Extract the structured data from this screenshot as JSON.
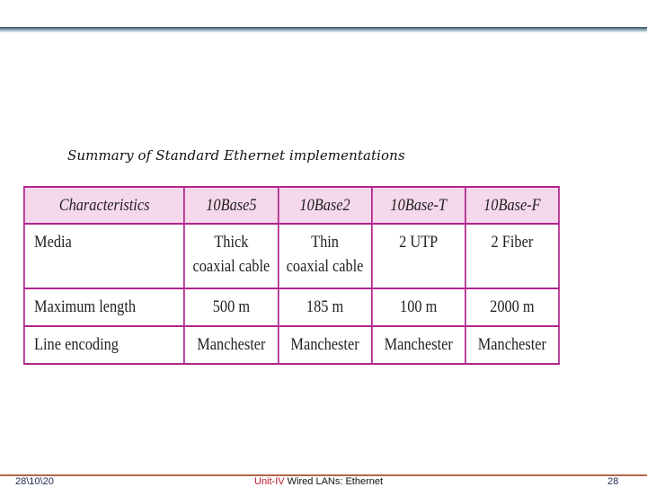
{
  "slide": {
    "caption": "Summary of Standard Ethernet implementations",
    "table": {
      "headers": [
        "Characteristics",
        "10Base5",
        "10Base2",
        "10Base-T",
        "10Base-F"
      ],
      "rows": [
        {
          "label": "Media",
          "values": [
            "Thick coaxial cable",
            "Thin coaxial cable",
            "2 UTP",
            "2 Fiber"
          ],
          "lines": [
            [
              "Thick",
              "coaxial cable"
            ],
            [
              "Thin",
              "coaxial cable"
            ],
            [
              "2 UTP",
              ""
            ],
            [
              "2 Fiber",
              ""
            ]
          ]
        },
        {
          "label": "Maximum length",
          "values": [
            "500 m",
            "185 m",
            "100 m",
            "2000 m"
          ]
        },
        {
          "label": "Line encoding",
          "values": [
            "Manchester",
            "Manchester",
            "Manchester",
            "Manchester"
          ]
        }
      ]
    },
    "colors": {
      "header_bg": "#f5d8ec",
      "border": "#b0268e",
      "footer_rule": "#b5664a",
      "unit_label": "#c0162a"
    }
  },
  "footer": {
    "date": "28\\10\\20",
    "unit": "Unit-IV",
    "title": " Wired LANs: Ethernet",
    "page": "28"
  }
}
